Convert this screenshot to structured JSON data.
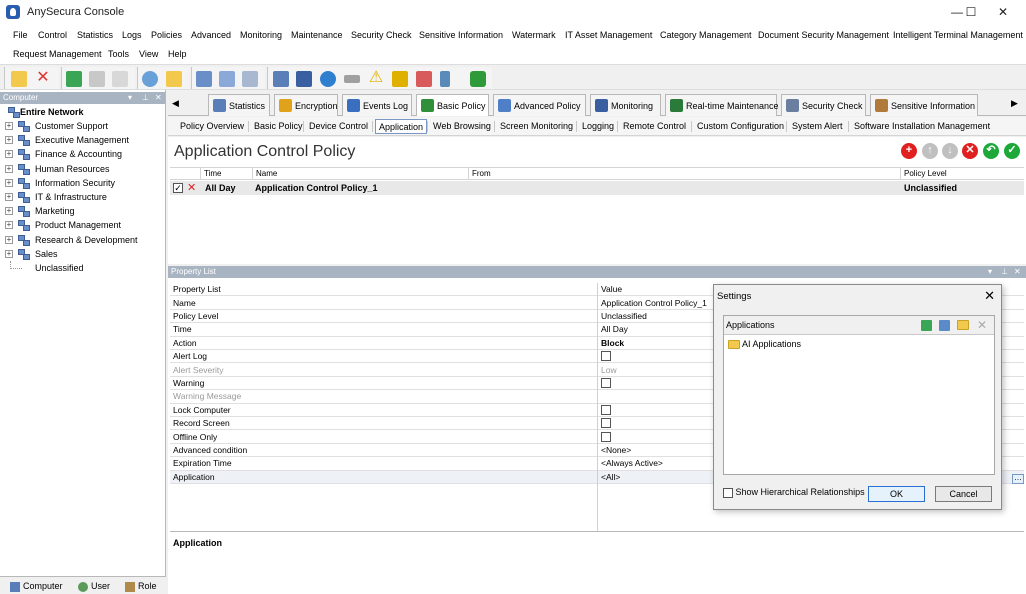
{
  "window": {
    "title": "AnySecura Console",
    "controls": [
      "—",
      "☐",
      "✕"
    ]
  },
  "menu": {
    "row1": [
      "File",
      "Control",
      "Statistics",
      "Logs",
      "Policies",
      "Advanced",
      "Monitoring",
      "Maintenance",
      "Security Check",
      "Sensitive Information",
      "Watermark",
      "IT Asset Management",
      "Category Management",
      "Document Security Management",
      "Intelligent Terminal Management"
    ],
    "row2": [
      "Request Management",
      "Tools",
      "View",
      "Help"
    ]
  },
  "toolbar": {
    "icons": [
      "open-folder-icon",
      "delete-icon",
      "export-icon",
      "print-icon",
      "print-preview-icon",
      "network-globe-icon",
      "key-icon",
      "computers-icon",
      "find-icon",
      "report-icon",
      "monitor-icon",
      "remote-icon",
      "web-icon",
      "drive-icon",
      "warning-icon",
      "lock-icon",
      "edit-icon",
      "mobile-icon",
      "refresh-icon"
    ]
  },
  "left_pane": {
    "header": "Computer",
    "root": "Entire Network",
    "groups": [
      "Customer Support",
      "Executive Management",
      "Finance & Accounting",
      "Human Resources",
      "Information Security",
      "IT & Infrastructure",
      "Marketing",
      "Product Management",
      "Research & Development",
      "Sales"
    ],
    "unclassified": "Unclassified",
    "bottom_tabs": [
      "Computer",
      "User",
      "Role"
    ]
  },
  "main_tabs": [
    {
      "label": "Statistics",
      "color": "#5a7fb8"
    },
    {
      "label": "Encryption",
      "color": "#e0a21b"
    },
    {
      "label": "Events Log",
      "color": "#3a6fc0"
    },
    {
      "label": "Basic Policy",
      "color": "#2f8f3a"
    },
    {
      "label": "Advanced Policy",
      "color": "#4f7fc6"
    },
    {
      "label": "Monitoring",
      "color": "#3a5fa0"
    },
    {
      "label": "Real-time Maintenance",
      "color": "#2a7a3a"
    },
    {
      "label": "Security Check",
      "color": "#6a7fa0"
    },
    {
      "label": "Sensitive Information",
      "color": "#b07a3a"
    }
  ],
  "sub_tabs": [
    "Policy Overview",
    "Basic Policy",
    "Device Control",
    "Application",
    "Web Browsing",
    "Screen Monitoring",
    "Logging",
    "Remote Control",
    "Custom Configuration",
    "System Alert",
    "Software Installation Management"
  ],
  "policy": {
    "title": "Application Control Policy",
    "columns": [
      "Time",
      "Name",
      "From",
      "Policy Level"
    ],
    "row": {
      "time": "All Day",
      "name": "Application Control Policy_1",
      "from": "",
      "level": "Unclassified"
    },
    "action_colors": {
      "add": "#e02020",
      "up": "#c0c0c0",
      "down": "#c0c0c0",
      "delete": "#e02020",
      "import": "#1ea83a",
      "apply": "#1ea83a"
    }
  },
  "property_list": {
    "header": "Property List",
    "columns": [
      "Property List",
      "Value"
    ],
    "rows": [
      {
        "key": "Name",
        "value": "Application Control Policy_1"
      },
      {
        "key": "Policy Level",
        "value": "Unclassified"
      },
      {
        "key": "Time",
        "value": "All Day"
      },
      {
        "key": "Action",
        "value": "Block"
      },
      {
        "key": "Alert Log",
        "value": ""
      },
      {
        "key": "Alert Severity",
        "value": "Low"
      },
      {
        "key": "Warning",
        "value": ""
      },
      {
        "key": "Warning Message",
        "value": ""
      },
      {
        "key": "Lock Computer",
        "value": ""
      },
      {
        "key": "Record Screen",
        "value": ""
      },
      {
        "key": "Offline Only",
        "value": ""
      },
      {
        "key": "Advanced condition",
        "value": "<None>"
      },
      {
        "key": "Expiration Time",
        "value": "<Always Active>"
      },
      {
        "key": "Application",
        "value": "<All>"
      }
    ],
    "footer_label": "Application"
  },
  "settings_dialog": {
    "title": "Settings",
    "box_label": "Applications",
    "item": "AI Applications",
    "checkbox_label": "Show Hierarchical Relationships",
    "ok": "OK",
    "cancel": "Cancel"
  }
}
